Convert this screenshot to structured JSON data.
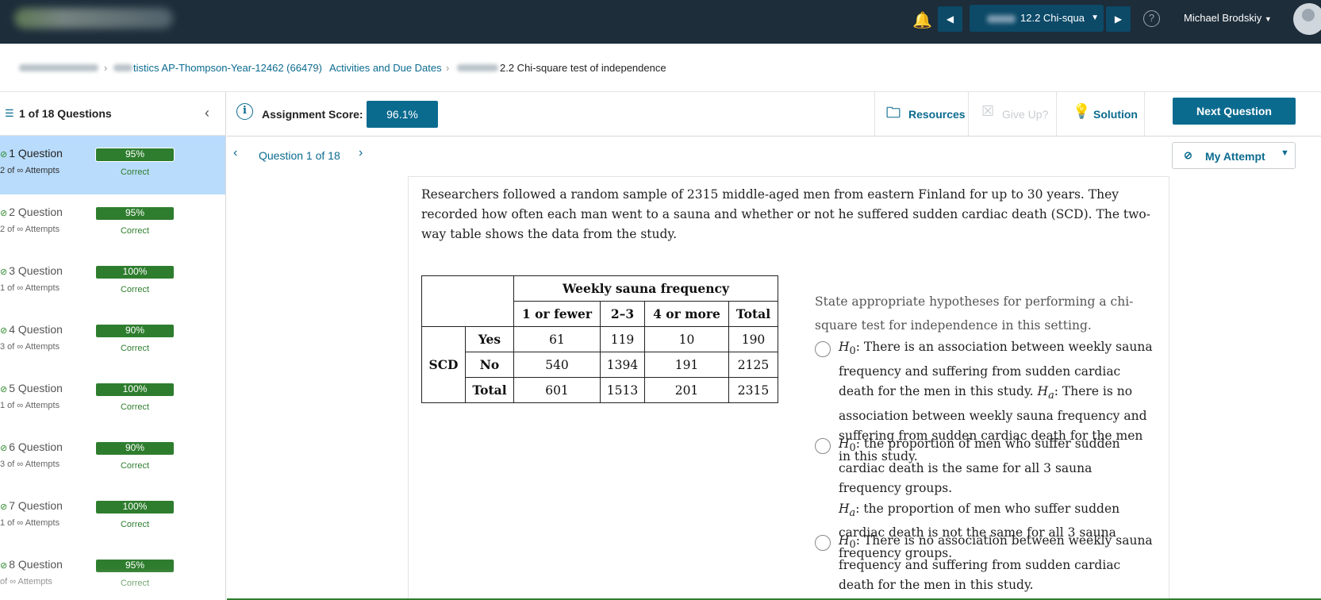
{
  "topbar": {
    "assignment_label": "12.2 Chi-squa",
    "user_name": "Michael Brodskiy",
    "icons": [
      "bell-icon",
      "prev-assignment-icon",
      "next-assignment-icon",
      "help-icon",
      "avatar"
    ]
  },
  "breadcrumb": {
    "course": "tistics AP-Thompson-Year-12462 (66479)",
    "activities": "Activities and Due Dates",
    "current": "2.2 Chi-square test of independence"
  },
  "sidebar": {
    "header": "1 of 18 Questions",
    "items": [
      {
        "label": "1 Question",
        "attempts": "2 of ∞ Attempts",
        "score": "95%",
        "status": "Correct",
        "progress": 0.95
      },
      {
        "label": "2 Question",
        "attempts": "2 of ∞ Attempts",
        "score": "95%",
        "status": "Correct",
        "progress": 0.95
      },
      {
        "label": "3 Question",
        "attempts": "1 of ∞ Attempts",
        "score": "100%",
        "status": "Correct",
        "progress": 1.0
      },
      {
        "label": "4 Question",
        "attempts": "3 of ∞ Attempts",
        "score": "90%",
        "status": "Correct",
        "progress": 0.9
      },
      {
        "label": "5 Question",
        "attempts": "1 of ∞ Attempts",
        "score": "100%",
        "status": "Correct",
        "progress": 1.0
      },
      {
        "label": "6 Question",
        "attempts": "3 of ∞ Attempts",
        "score": "90%",
        "status": "Correct",
        "progress": 0.9
      },
      {
        "label": "7 Question",
        "attempts": "1 of ∞ Attempts",
        "score": "100%",
        "status": "Correct",
        "progress": 1.0
      },
      {
        "label": "8 Question",
        "attempts": "of ∞ Attempts",
        "score": "95%",
        "status": "Correct",
        "progress": 0.95
      }
    ]
  },
  "scorebar": {
    "score_label": "Assignment Score:",
    "score_value": "96.1%",
    "resources": "Resources",
    "give_up": "Give Up?",
    "solution": "Solution",
    "next_question": "Next Question"
  },
  "qnav": {
    "label": "Question 1 of 18",
    "my_attempt": "My Attempt"
  },
  "question": {
    "text": "Researchers followed a random sample of 2315 middle-aged men from eastern Finland for up to 30 years. They recorded how often each man went to a sauna and whether or not he suffered sudden cardiac death (SCD). The two-way table shows the data from the study.",
    "table": {
      "group_header": "Weekly sauna frequency",
      "row_group": "SCD",
      "columns": [
        "1 or fewer",
        "2–3",
        "4 or more",
        "Total"
      ],
      "rows": [
        {
          "label": "Yes",
          "values": [
            "61",
            "119",
            "10",
            "190"
          ]
        },
        {
          "label": "No",
          "values": [
            "540",
            "1394",
            "191",
            "2125"
          ]
        },
        {
          "label": "Total",
          "values": [
            "601",
            "1513",
            "201",
            "2315"
          ]
        }
      ]
    },
    "prompt": "State appropriate hypotheses for performing a chi-square test for independence in this setting.",
    "options": [
      {
        "h0": ": There is an association between weekly sauna frequency and suffering from sudden cardiac death for the men in this study. ",
        "ha": ": There is no association between weekly sauna frequency and suffering from sudden cardiac death for the men in this study."
      },
      {
        "h0": ": the proportion of men who suffer sudden cardiac death is the same for all 3 sauna frequency groups. ",
        "ha": ": the proportion of men who suffer sudden cardiac death is not the same for all 3 sauna frequency groups."
      },
      {
        "h0": ": There is no association between weekly sauna frequency and suffering from sudden cardiac death for the men in this study.",
        "ha": ""
      }
    ]
  }
}
